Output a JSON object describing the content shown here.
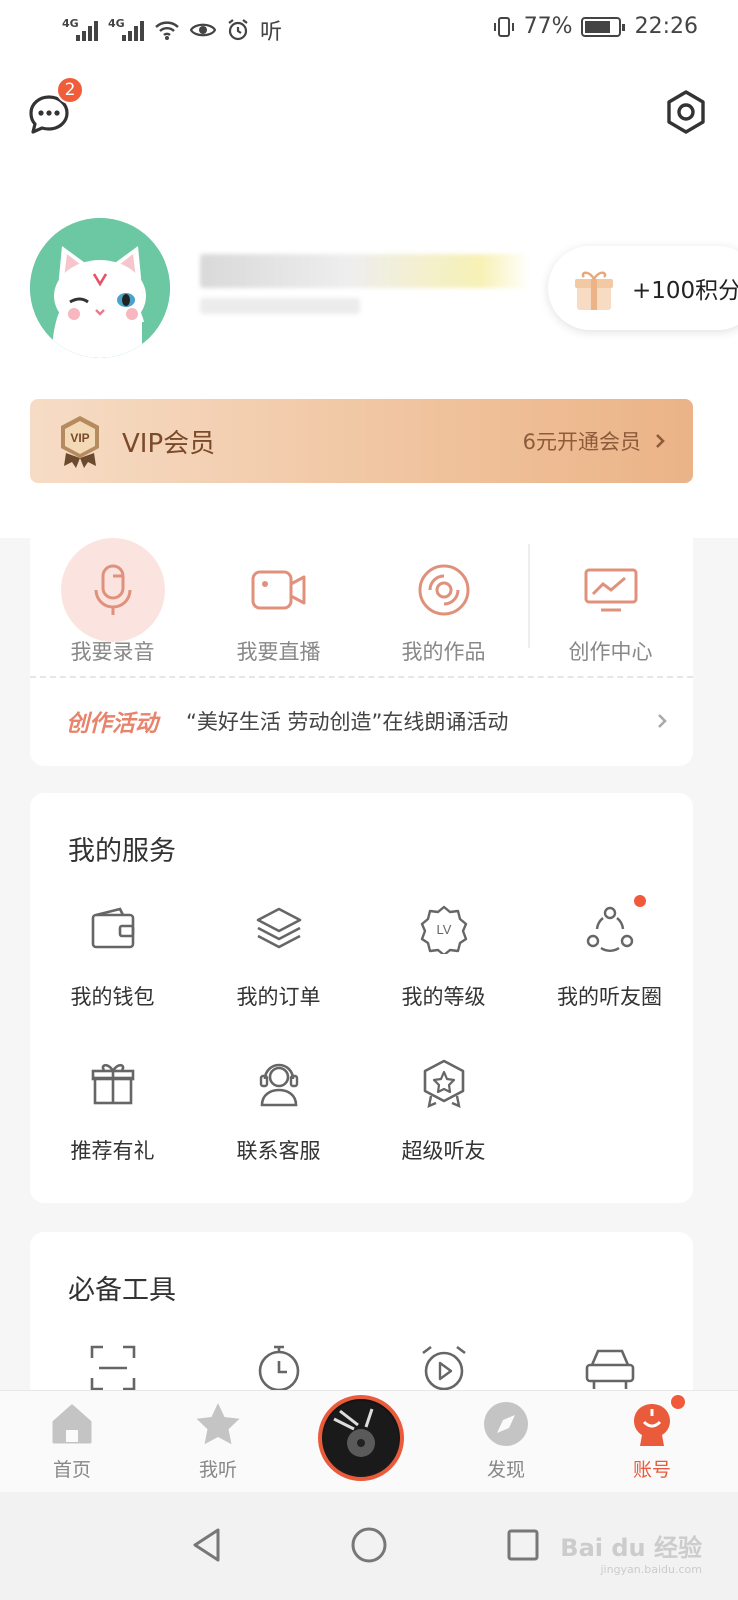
{
  "status_bar": {
    "net1": "4G",
    "net2": "4G",
    "listen_text": "听",
    "battery": "77%",
    "time": "22:26"
  },
  "header": {
    "message_badge": "2",
    "points_label": "+100积分"
  },
  "vip": {
    "badge": "VIP",
    "title": "VIP会员",
    "cta": "6元开通会员"
  },
  "create": {
    "items": [
      {
        "label": "我要录音",
        "icon": "microphone-icon"
      },
      {
        "label": "我要直播",
        "icon": "video-camera-icon"
      },
      {
        "label": "我的作品",
        "icon": "disc-icon"
      },
      {
        "label": "创作中心",
        "icon": "monitor-chart-icon"
      }
    ],
    "activity_tag": "创作活动",
    "activity_text": "“美好生活 劳动创造”在线朗诵活动"
  },
  "services": {
    "title": "我的服务",
    "items": [
      {
        "label": "我的钱包",
        "icon": "wallet-icon"
      },
      {
        "label": "我的订单",
        "icon": "layers-icon"
      },
      {
        "label": "我的等级",
        "icon": "level-badge-icon"
      },
      {
        "label": "我的听友圈",
        "icon": "friends-circle-icon",
        "dot": true
      },
      {
        "label": "推荐有礼",
        "icon": "gift-icon"
      },
      {
        "label": "联系客服",
        "icon": "customer-service-icon"
      },
      {
        "label": "超级听友",
        "icon": "star-shield-icon"
      }
    ]
  },
  "tools": {
    "title": "必备工具"
  },
  "tabbar": {
    "items": [
      {
        "label": "首页",
        "icon": "home-icon"
      },
      {
        "label": "我听",
        "icon": "star-icon"
      },
      {
        "label": "发现",
        "icon": "compass-icon"
      },
      {
        "label": "账号",
        "icon": "account-icon",
        "active": true
      }
    ]
  },
  "watermark": {
    "brand": "Bai du 经验",
    "url": "jingyan.baidu.com"
  },
  "colors": {
    "accent": "#ea5b3b",
    "icon_line": "#e0917b",
    "vip_text": "#7a4a2a"
  }
}
